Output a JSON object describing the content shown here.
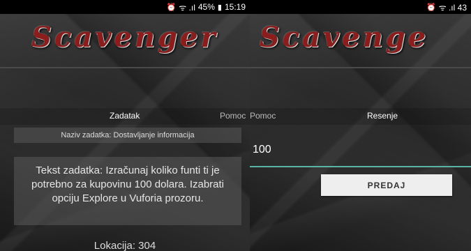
{
  "left": {
    "status": {
      "signal": "ᯤ .ıl",
      "battery": "45%",
      "battery_icon": "▮",
      "time": "15:19"
    },
    "logo": "Scavenger",
    "tabs": {
      "active": "Zadatak",
      "next": "Pomoc"
    },
    "task_name": "Naziv zadatka: Dostavljanje informacija",
    "task_text": "Tekst zadatka: Izračunaj koliko funti ti je potrebno za kupovinu 100 dolara. Izabrati opciju Explore u Vuforia prozoru.",
    "location": "Lokacija: 304"
  },
  "right": {
    "status": {
      "signal": "ᯤ .ıl 43"
    },
    "logo": "Scavenge",
    "tabs": {
      "prev": "Pomoc",
      "active": "Resenje"
    },
    "answer_value": "100",
    "submit_label": "PREDAJ"
  },
  "colors": {
    "accent": "#58b5a4",
    "logo_red": "#8b1d1d"
  }
}
